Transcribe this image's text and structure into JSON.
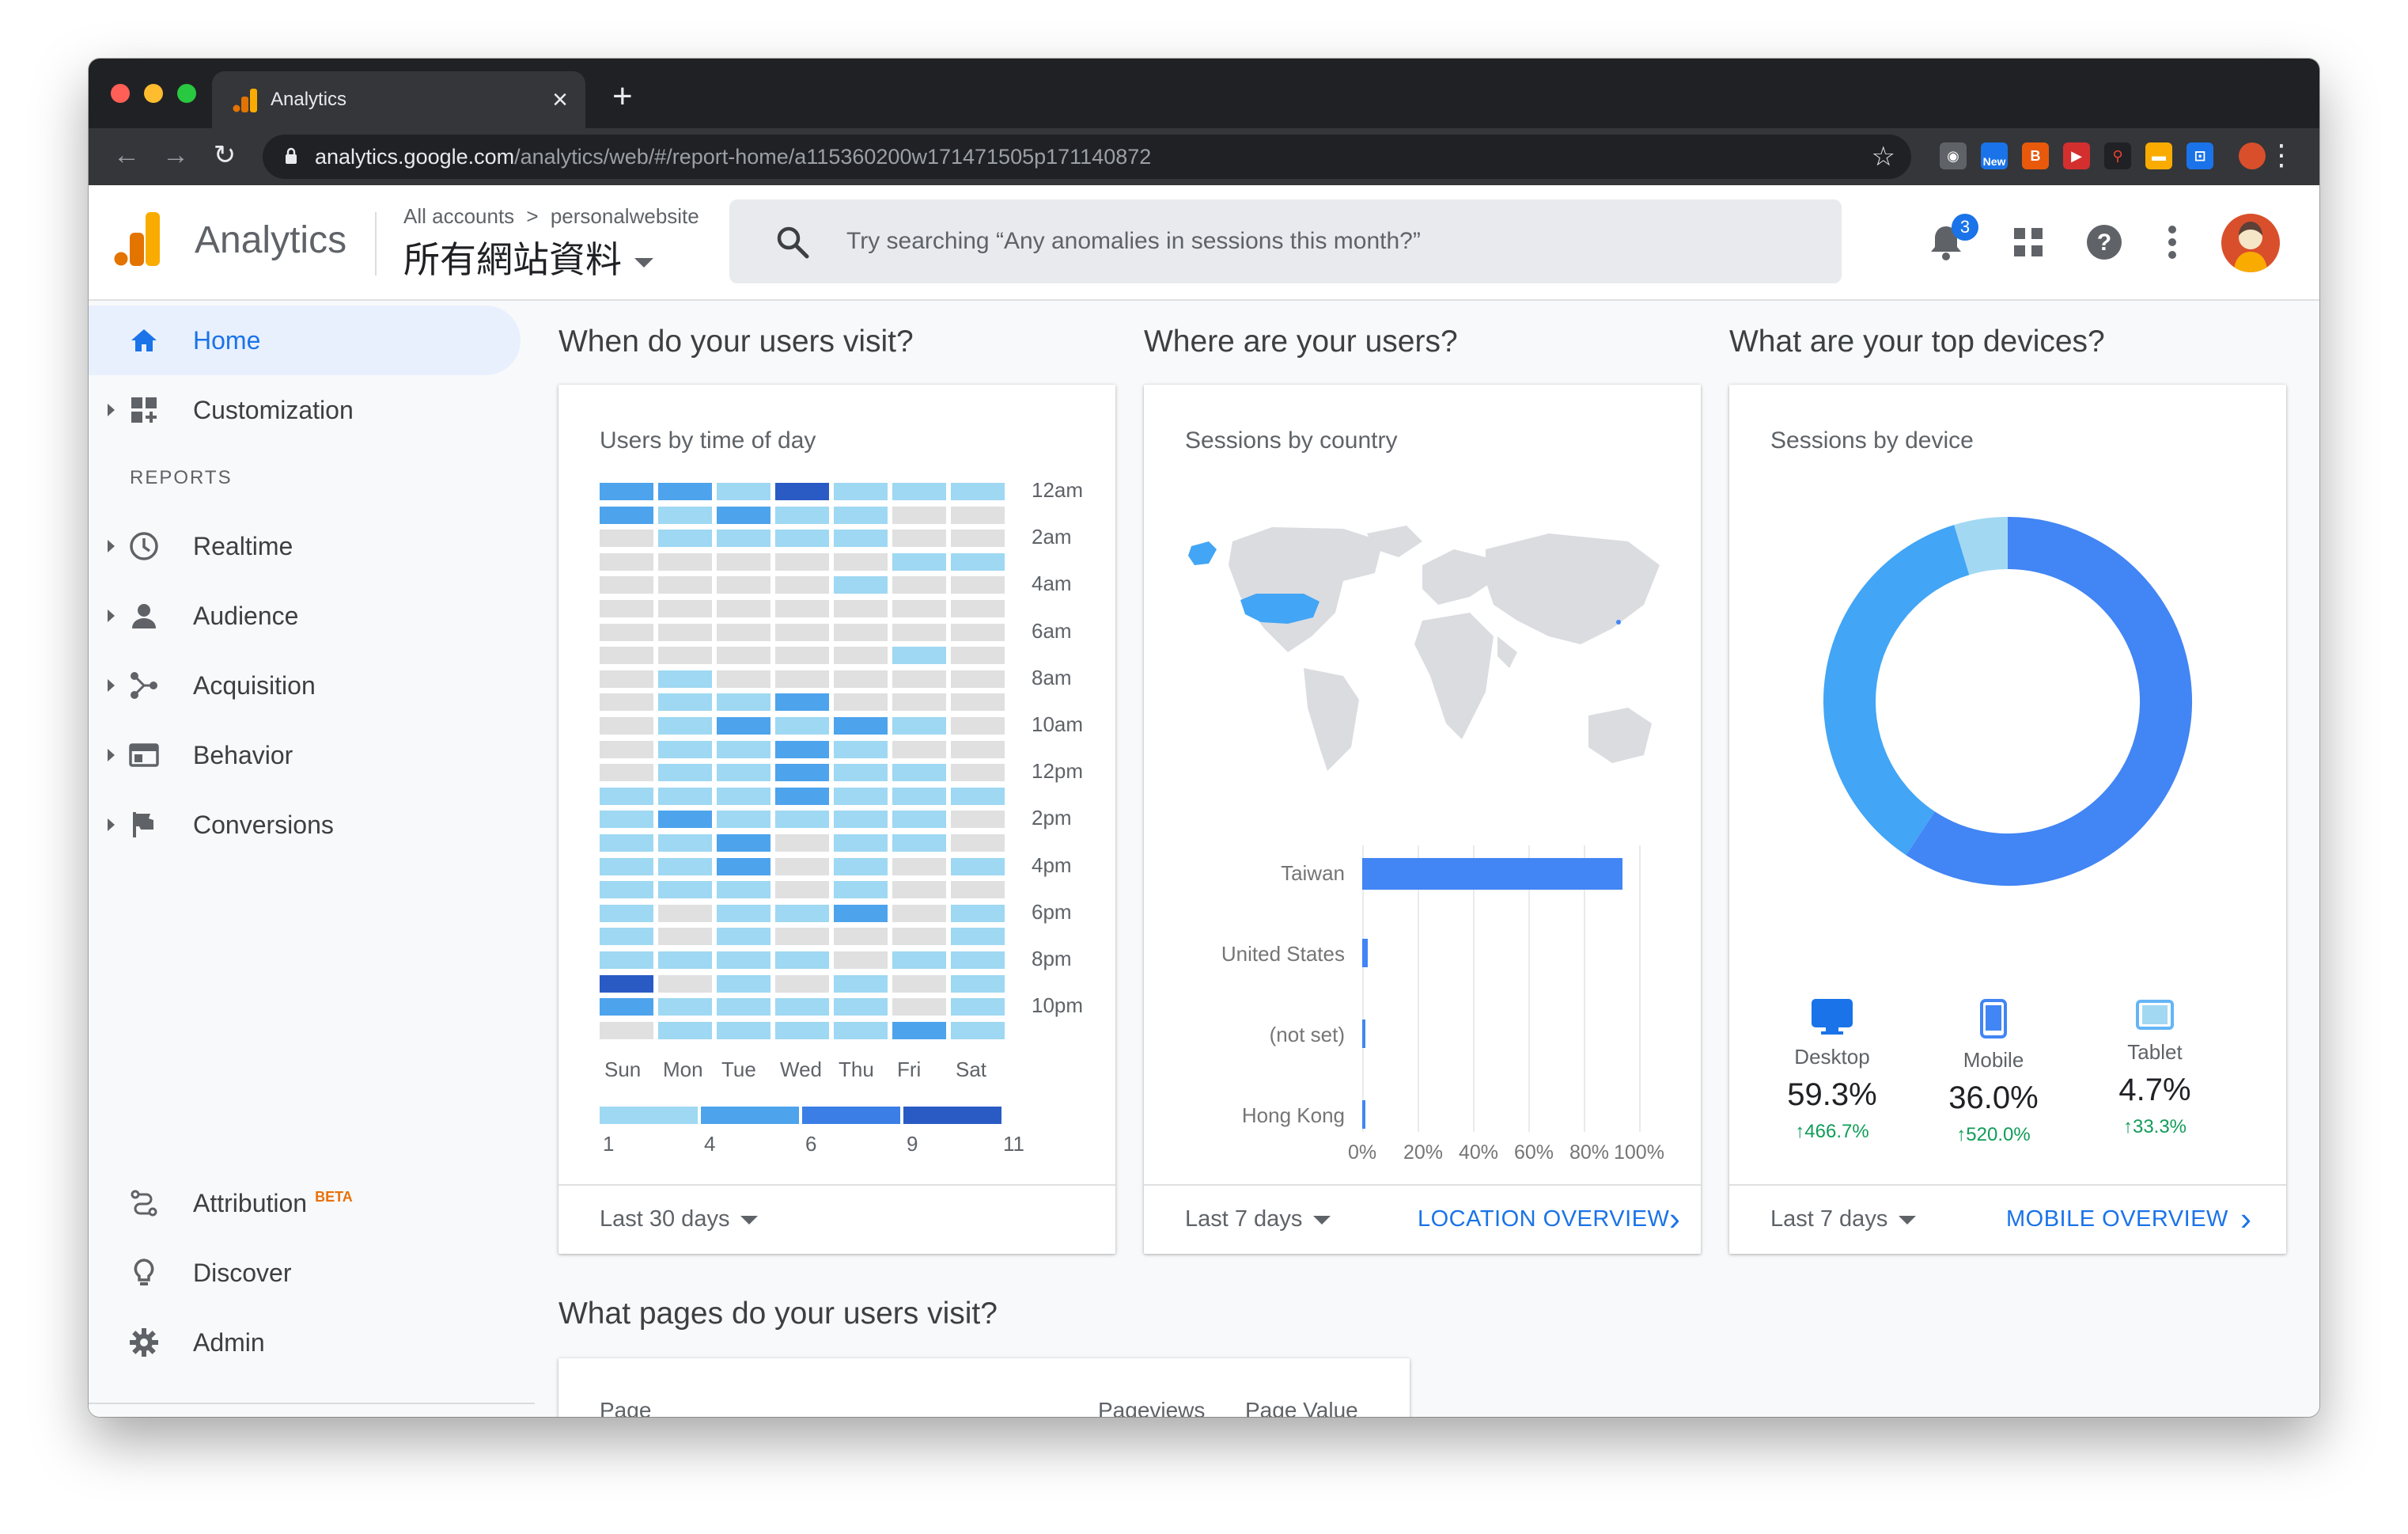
{
  "browser": {
    "tab_title": "Analytics",
    "tab_close": "×",
    "new_tab": "+",
    "url_host": "analytics.google.com",
    "url_path": "/analytics/web/#/report-home/a115360200w171471505p171140872",
    "ext_new_label": "New"
  },
  "header": {
    "app_name": "Analytics",
    "account_path_root": "All accounts",
    "account_path_sep": ">",
    "account_path_property": "personalwebsite",
    "view_name": "所有網站資料",
    "search_placeholder": "Try searching “Any anomalies in sessions this month?”",
    "notification_count": "3"
  },
  "sidebar": {
    "home": "Home",
    "customization": "Customization",
    "reports_heading": "REPORTS",
    "realtime": "Realtime",
    "audience": "Audience",
    "acquisition": "Acquisition",
    "behavior": "Behavior",
    "conversions": "Conversions",
    "attribution": "Attribution",
    "attribution_badge": "BETA",
    "discover": "Discover",
    "admin": "Admin"
  },
  "sections": {
    "time": "When do your users visit?",
    "where": "Where are your users?",
    "devices": "What are your top devices?",
    "pages": "What pages do your users visit?"
  },
  "time_card": {
    "title": "Users by time of day",
    "period": "Last 30 days",
    "hour_labels": [
      "12am",
      "2am",
      "4am",
      "6am",
      "8am",
      "10am",
      "12pm",
      "2pm",
      "4pm",
      "6pm",
      "8pm",
      "10pm"
    ],
    "day_labels": [
      "Sun",
      "Mon",
      "Tue",
      "Wed",
      "Thu",
      "Fri",
      "Sat"
    ],
    "scale_labels": [
      "1",
      "4",
      "6",
      "9",
      "11"
    ],
    "scale_colors": [
      "#9ed8f2",
      "#4da3ec",
      "#3a7ee6",
      "#2a5bc5"
    ],
    "heat_colors": [
      "#e0e0e0",
      "#9ed8f2",
      "#4da3ec",
      "#2a5bc5"
    ],
    "heat_rows": [
      [
        2,
        2,
        1,
        3,
        1,
        1,
        1
      ],
      [
        2,
        1,
        2,
        1,
        1,
        0,
        0
      ],
      [
        0,
        1,
        1,
        1,
        1,
        0,
        0
      ],
      [
        0,
        0,
        0,
        0,
        0,
        1,
        1
      ],
      [
        0,
        0,
        0,
        0,
        1,
        0,
        0
      ],
      [
        0,
        0,
        0,
        0,
        0,
        0,
        0
      ],
      [
        0,
        0,
        0,
        0,
        0,
        0,
        0
      ],
      [
        0,
        0,
        0,
        0,
        0,
        1,
        0
      ],
      [
        0,
        1,
        0,
        0,
        0,
        0,
        0
      ],
      [
        0,
        1,
        1,
        2,
        0,
        0,
        0
      ],
      [
        0,
        1,
        2,
        1,
        2,
        1,
        0
      ],
      [
        0,
        1,
        1,
        2,
        1,
        0,
        0
      ],
      [
        0,
        1,
        1,
        2,
        1,
        1,
        0
      ],
      [
        1,
        1,
        1,
        2,
        1,
        1,
        1
      ],
      [
        1,
        2,
        1,
        1,
        1,
        1,
        0
      ],
      [
        1,
        1,
        2,
        0,
        1,
        1,
        0
      ],
      [
        1,
        1,
        2,
        0,
        1,
        0,
        1
      ],
      [
        1,
        1,
        1,
        0,
        1,
        0,
        0
      ],
      [
        1,
        0,
        1,
        1,
        2,
        0,
        1
      ],
      [
        1,
        0,
        1,
        0,
        0,
        0,
        1
      ],
      [
        1,
        1,
        1,
        1,
        0,
        1,
        1
      ],
      [
        3,
        0,
        1,
        0,
        1,
        0,
        1
      ],
      [
        2,
        1,
        1,
        1,
        1,
        0,
        1
      ],
      [
        0,
        1,
        1,
        1,
        1,
        2,
        1
      ]
    ]
  },
  "country_card": {
    "title": "Sessions by country",
    "period": "Last 7 days",
    "link": "LOCATION OVERVIEW",
    "axis_ticks": [
      "0%",
      "20%",
      "40%",
      "60%",
      "80%",
      "100%"
    ]
  },
  "chart_data": {
    "type": "bar",
    "orientation": "horizontal",
    "categories": [
      "Taiwan",
      "United States",
      "(not set)",
      "Hong Kong"
    ],
    "values": [
      96,
      2,
      1,
      1
    ],
    "xlim": [
      0,
      100
    ],
    "unit": "%"
  },
  "device_card": {
    "title": "Sessions by device",
    "period": "Last 7 days",
    "link": "MOBILE OVERVIEW",
    "devices": [
      {
        "name": "Desktop",
        "share": "59.3%",
        "change": "↑466.7%",
        "value": 59.3,
        "color": "#4285f4"
      },
      {
        "name": "Mobile",
        "share": "36.0%",
        "change": "↑520.0%",
        "value": 36.0,
        "color": "#42a5f5"
      },
      {
        "name": "Tablet",
        "share": "4.7%",
        "change": "↑33.3%",
        "value": 4.7,
        "color": "#a3d8f2"
      }
    ]
  },
  "pages_card": {
    "col_page": "Page",
    "col_pageviews": "Pageviews",
    "col_value": "Page Value"
  }
}
